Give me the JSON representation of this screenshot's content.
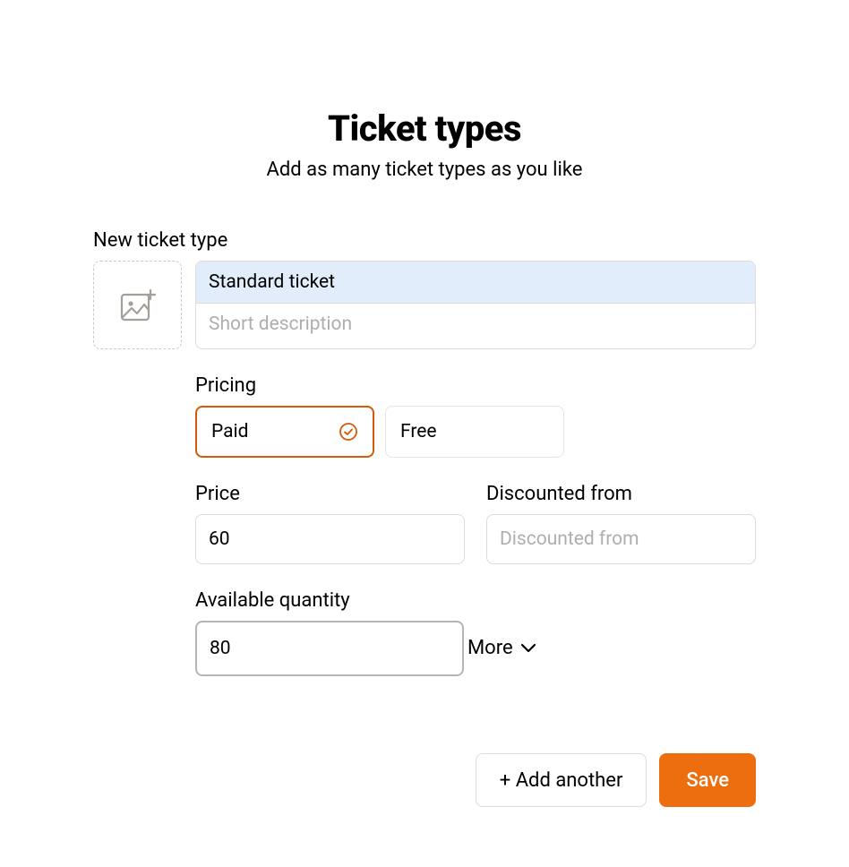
{
  "header": {
    "title": "Ticket types",
    "subtitle": "Add as many ticket types as you like"
  },
  "form": {
    "section_label": "New ticket type",
    "ticket_name": "Standard ticket",
    "description_placeholder": "Short description",
    "description_value": "",
    "pricing_label": "Pricing",
    "pricing_options": {
      "paid": "Paid",
      "free": "Free"
    },
    "pricing_selected": "paid",
    "price_label": "Price",
    "price_value": "60",
    "discount_label": "Discounted from",
    "discount_placeholder": "Discounted from",
    "discount_value": "",
    "quantity_label": "Available quantity",
    "quantity_value": "80",
    "more_label": "More"
  },
  "footer": {
    "add_another_label": "+ Add another",
    "save_label": "Save"
  },
  "icons": {
    "image_upload": "image-add-icon",
    "check": "check-circle-icon",
    "chevron": "chevron-down-icon"
  }
}
